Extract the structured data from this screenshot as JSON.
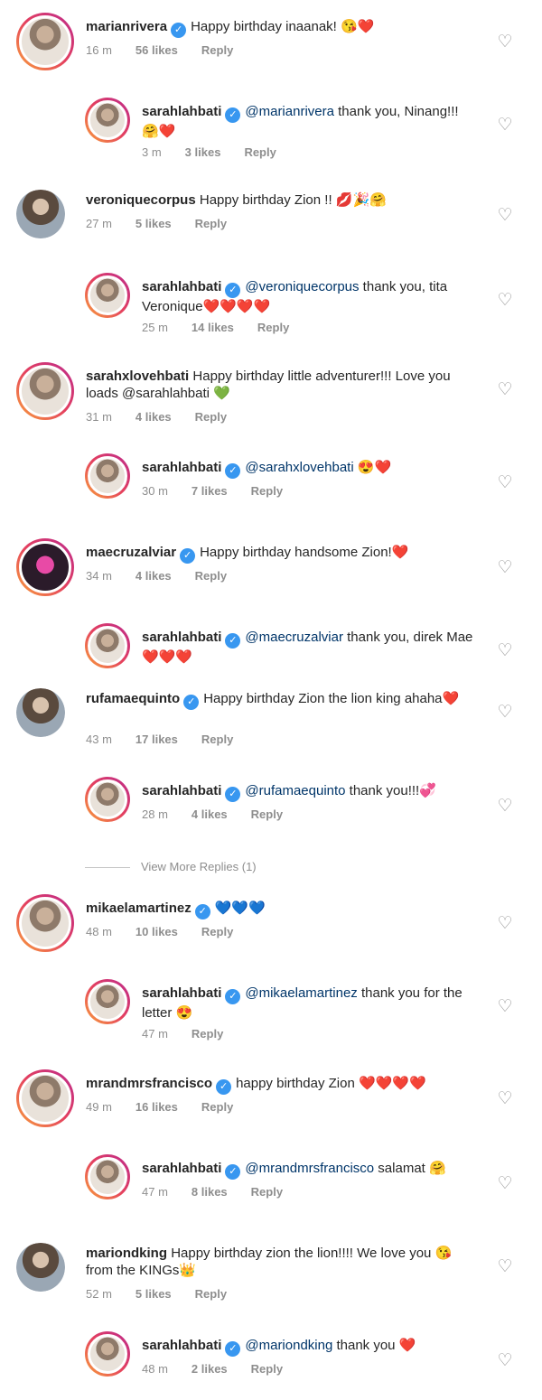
{
  "comments": [
    {
      "user": "marianrivera",
      "verified": true,
      "mention": "",
      "text": "Happy birthday inaanak! 😘❤️",
      "time": "16 m",
      "likes": "56 likes",
      "reply": "Reply"
    },
    {
      "user": "sarahlahbati",
      "verified": true,
      "mention": "@marianrivera",
      "text": " thank you, Ninang!!! 🤗❤️",
      "time": "3 m",
      "likes": "3 likes",
      "reply": "Reply"
    },
    {
      "user": "veroniquecorpus",
      "verified": false,
      "mention": "",
      "text": "Happy birthday Zion !! 💋🎉🤗",
      "time": "27 m",
      "likes": "5 likes",
      "reply": "Reply"
    },
    {
      "user": "sarahlahbati",
      "verified": true,
      "mention": "@veroniquecorpus",
      "text": " thank you, tita Veronique❤️❤️❤️❤️",
      "time": "25 m",
      "likes": "14 likes",
      "reply": "Reply"
    },
    {
      "user": "sarahxlovehbati",
      "verified": false,
      "mention": "",
      "text": "Happy birthday little adventurer!!! Love you loads @sarahlahbati 💚",
      "time": "31 m",
      "likes": "4 likes",
      "reply": "Reply"
    },
    {
      "user": "sarahlahbati",
      "verified": true,
      "mention": "@sarahxlovehbati",
      "text": " 😍❤️",
      "time": "30 m",
      "likes": "7 likes",
      "reply": "Reply"
    },
    {
      "user": "maecruzalviar",
      "verified": true,
      "mention": "",
      "text": "Happy birthday handsome Zion!❤️",
      "time": "34 m",
      "likes": "4 likes",
      "reply": "Reply"
    },
    {
      "user": "sarahlahbati",
      "verified": true,
      "mention": "@maecruzalviar",
      "text": " thank you, direk Mae ❤️❤️❤️",
      "time": "",
      "likes": "",
      "reply": ""
    },
    {
      "user": "rufamaequinto",
      "verified": true,
      "mention": "",
      "text": "Happy birthday  Zion the lion king ahaha❤️",
      "time": "43 m",
      "likes": "17 likes",
      "reply": "Reply"
    },
    {
      "user": "sarahlahbati",
      "verified": true,
      "mention": "@rufamaequinto",
      "text": " thank you!!!💞",
      "time": "28 m",
      "likes": "4 likes",
      "reply": "Reply"
    },
    {
      "user": "mikaelamartinez",
      "verified": true,
      "mention": "",
      "text": "💙💙💙",
      "time": "48 m",
      "likes": "10 likes",
      "reply": "Reply"
    },
    {
      "user": "sarahlahbati",
      "verified": true,
      "mention": "@mikaelamartinez",
      "text": " thank you for the letter 😍",
      "time": "47 m",
      "likes": "",
      "reply": "Reply"
    },
    {
      "user": "mrandmrsfrancisco",
      "verified": true,
      "mention": "",
      "text": "happy birthday Zion ❤️❤️❤️❤️",
      "time": "49 m",
      "likes": "16 likes",
      "reply": "Reply"
    },
    {
      "user": "sarahlahbati",
      "verified": true,
      "mention": "@mrandmrsfrancisco",
      "text": " salamat 🤗",
      "time": "47 m",
      "likes": "8 likes",
      "reply": "Reply"
    },
    {
      "user": "mariondking",
      "verified": false,
      "mention": "",
      "text": "Happy birthday zion the lion!!!! We love you 😘 from the KINGs👑",
      "time": "52 m",
      "likes": "5 likes",
      "reply": "Reply"
    },
    {
      "user": "sarahlahbati",
      "verified": true,
      "mention": "@mariondking",
      "text": " thank you ❤️",
      "time": "48 m",
      "likes": "2 likes",
      "reply": "Reply"
    }
  ],
  "view_more": "View More Replies (1)",
  "icons": {
    "heart": "heart-outline-icon",
    "verified": "verified-badge-icon"
  }
}
